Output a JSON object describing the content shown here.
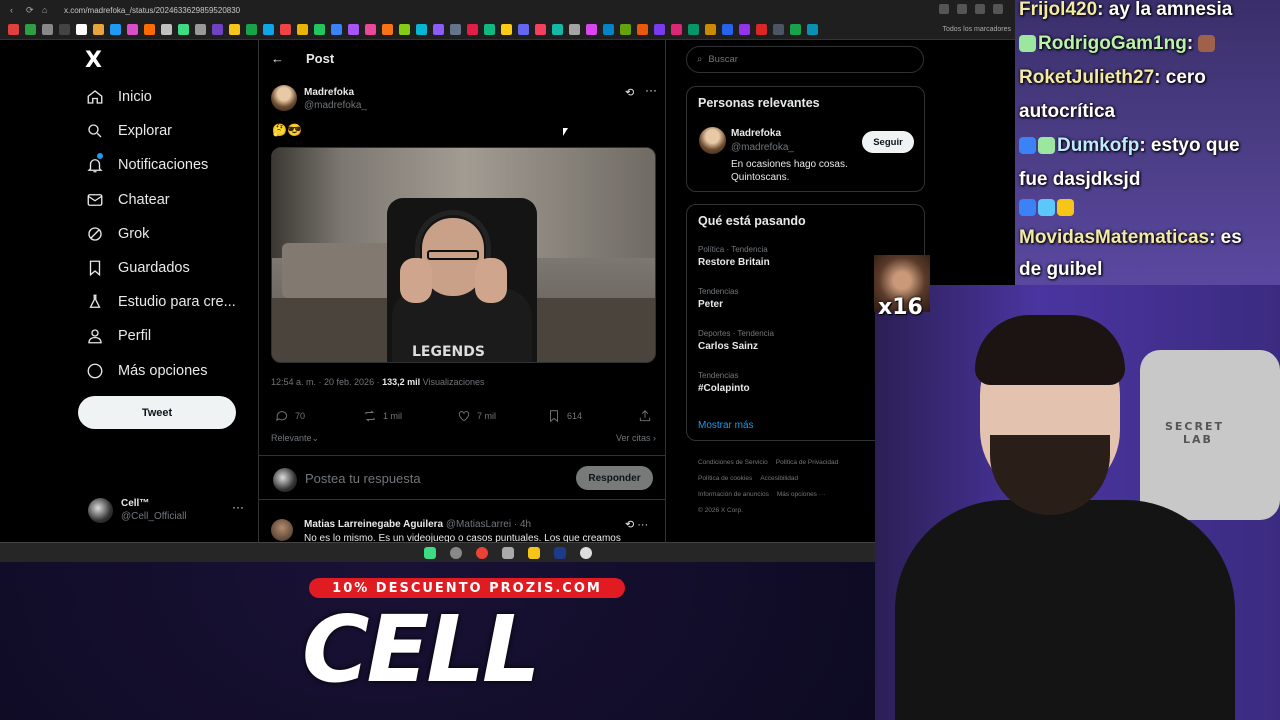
{
  "browser": {
    "url": "x.com/madrefoka_/status/2024633629859520830",
    "bookmarks_label": "Todos los marcadores",
    "bookmark_colors": [
      "#e04040",
      "#2ea043",
      "#888",
      "#444",
      "#ffffff",
      "#e8a33d",
      "#1d9bf0",
      "#d94ec6",
      "#ff6b00",
      "#c0c0c0",
      "#3ddc84",
      "#999",
      "#6f42c1",
      "#f5c518",
      "#16a34a",
      "#0ea5e9",
      "#ef4444",
      "#eab308",
      "#22c55e",
      "#3b82f6",
      "#a855f7",
      "#ec4899",
      "#f97316",
      "#84cc16",
      "#06b6d4",
      "#8b5cf6",
      "#64748b",
      "#e11d48",
      "#10b981",
      "#facc15",
      "#6366f1",
      "#f43f5e",
      "#14b8a6",
      "#a3a3a3",
      "#d946ef",
      "#0284c7",
      "#65a30d",
      "#ea580c",
      "#7c3aed",
      "#db2777",
      "#059669",
      "#ca8a04",
      "#2563eb",
      "#9333ea",
      "#dc2626",
      "#4b5563",
      "#16a34a",
      "#0891b2"
    ]
  },
  "nav": {
    "logo": "X",
    "items": [
      {
        "label": "Inicio",
        "icon": "home-icon"
      },
      {
        "label": "Explorar",
        "icon": "search-icon"
      },
      {
        "label": "Notificaciones",
        "icon": "bell-icon"
      },
      {
        "label": "Chatear",
        "icon": "mail-icon"
      },
      {
        "label": "Grok",
        "icon": "grok-icon"
      },
      {
        "label": "Guardados",
        "icon": "bookmark-icon"
      },
      {
        "label": "Estudio para cre...",
        "icon": "flask-icon"
      },
      {
        "label": "Perfil",
        "icon": "person-icon"
      },
      {
        "label": "Más opciones",
        "icon": "more-circle-icon"
      }
    ],
    "tweet_button": "Tweet",
    "account": {
      "name": "Cell™",
      "handle": "@Cell_Officiall",
      "more": "···"
    }
  },
  "post": {
    "header": "Post",
    "back": "←",
    "author_name": "Madrefoka",
    "author_handle": "@madrefoka_",
    "text": "🤔😎",
    "time": "12:54 a. m. · 20 feb. 2026 · ",
    "views": "133,2 mil",
    "views_label": "Visualizaciones",
    "video_logo": "LEGENDS",
    "actions": {
      "replies": "70",
      "reposts": "1 mil",
      "likes": "7 mil",
      "bookmarks": "614"
    },
    "sort_label": "Relevante",
    "quotes_label": "Ver citas",
    "reply_placeholder": "Postea tu respuesta",
    "reply_button": "Responder",
    "first_reply": {
      "name": "Matias Larreinegabe Aguilera",
      "handle": "@MatiasLarrei · 4h",
      "text": "No es lo mismo. Es un videojuego o casos puntuales. Los que creamos"
    }
  },
  "sidebar": {
    "search_placeholder": "Buscar",
    "relevant_title": "Personas relevantes",
    "person": {
      "name": "Madrefoka",
      "handle": "@madrefoka_",
      "bio": "En ocasiones hago cosas. Quintoscans.",
      "follow": "Seguir"
    },
    "trends_title": "Qué está pasando",
    "trends": [
      {
        "category": "Política · Tendencia",
        "name": "Restore Britain"
      },
      {
        "category": "Tendencias",
        "name": "Peter"
      },
      {
        "category": "Deportes · Tendencia",
        "name": "Carlos Sainz"
      },
      {
        "category": "Tendencias",
        "name": "#Colapinto"
      }
    ],
    "show_more": "Mostrar más",
    "footer": [
      "Condiciones de Servicio",
      "Política de Privacidad",
      "Política de cookies",
      "Accesibilidad",
      "Información de anuncios",
      "Más opciones ···",
      "© 2026 X Corp."
    ]
  },
  "stream": {
    "chat": [
      {
        "user": "Frijol420",
        "msg": ": ay la amnesia"
      },
      {
        "user": "RodrigoGam1ng",
        "msg": ":"
      },
      {
        "user": "RoketJulieth27",
        "msg": ": cero"
      },
      {
        "user": "",
        "msg": "autocrítica"
      },
      {
        "user": "Dumkofp",
        "msg": ": estyo que"
      },
      {
        "user": "",
        "msg": "fue dasjdksjd"
      },
      {
        "user": "MovidasMatematicas",
        "msg": ": es"
      },
      {
        "user": "",
        "msg": "de guibel"
      }
    ],
    "emote_count": "x16",
    "promo": "10% DESCUENTO PROZIS.COM",
    "brand": "CELL",
    "chair_logo_1": "SECRET",
    "chair_logo_2": "LAB"
  }
}
